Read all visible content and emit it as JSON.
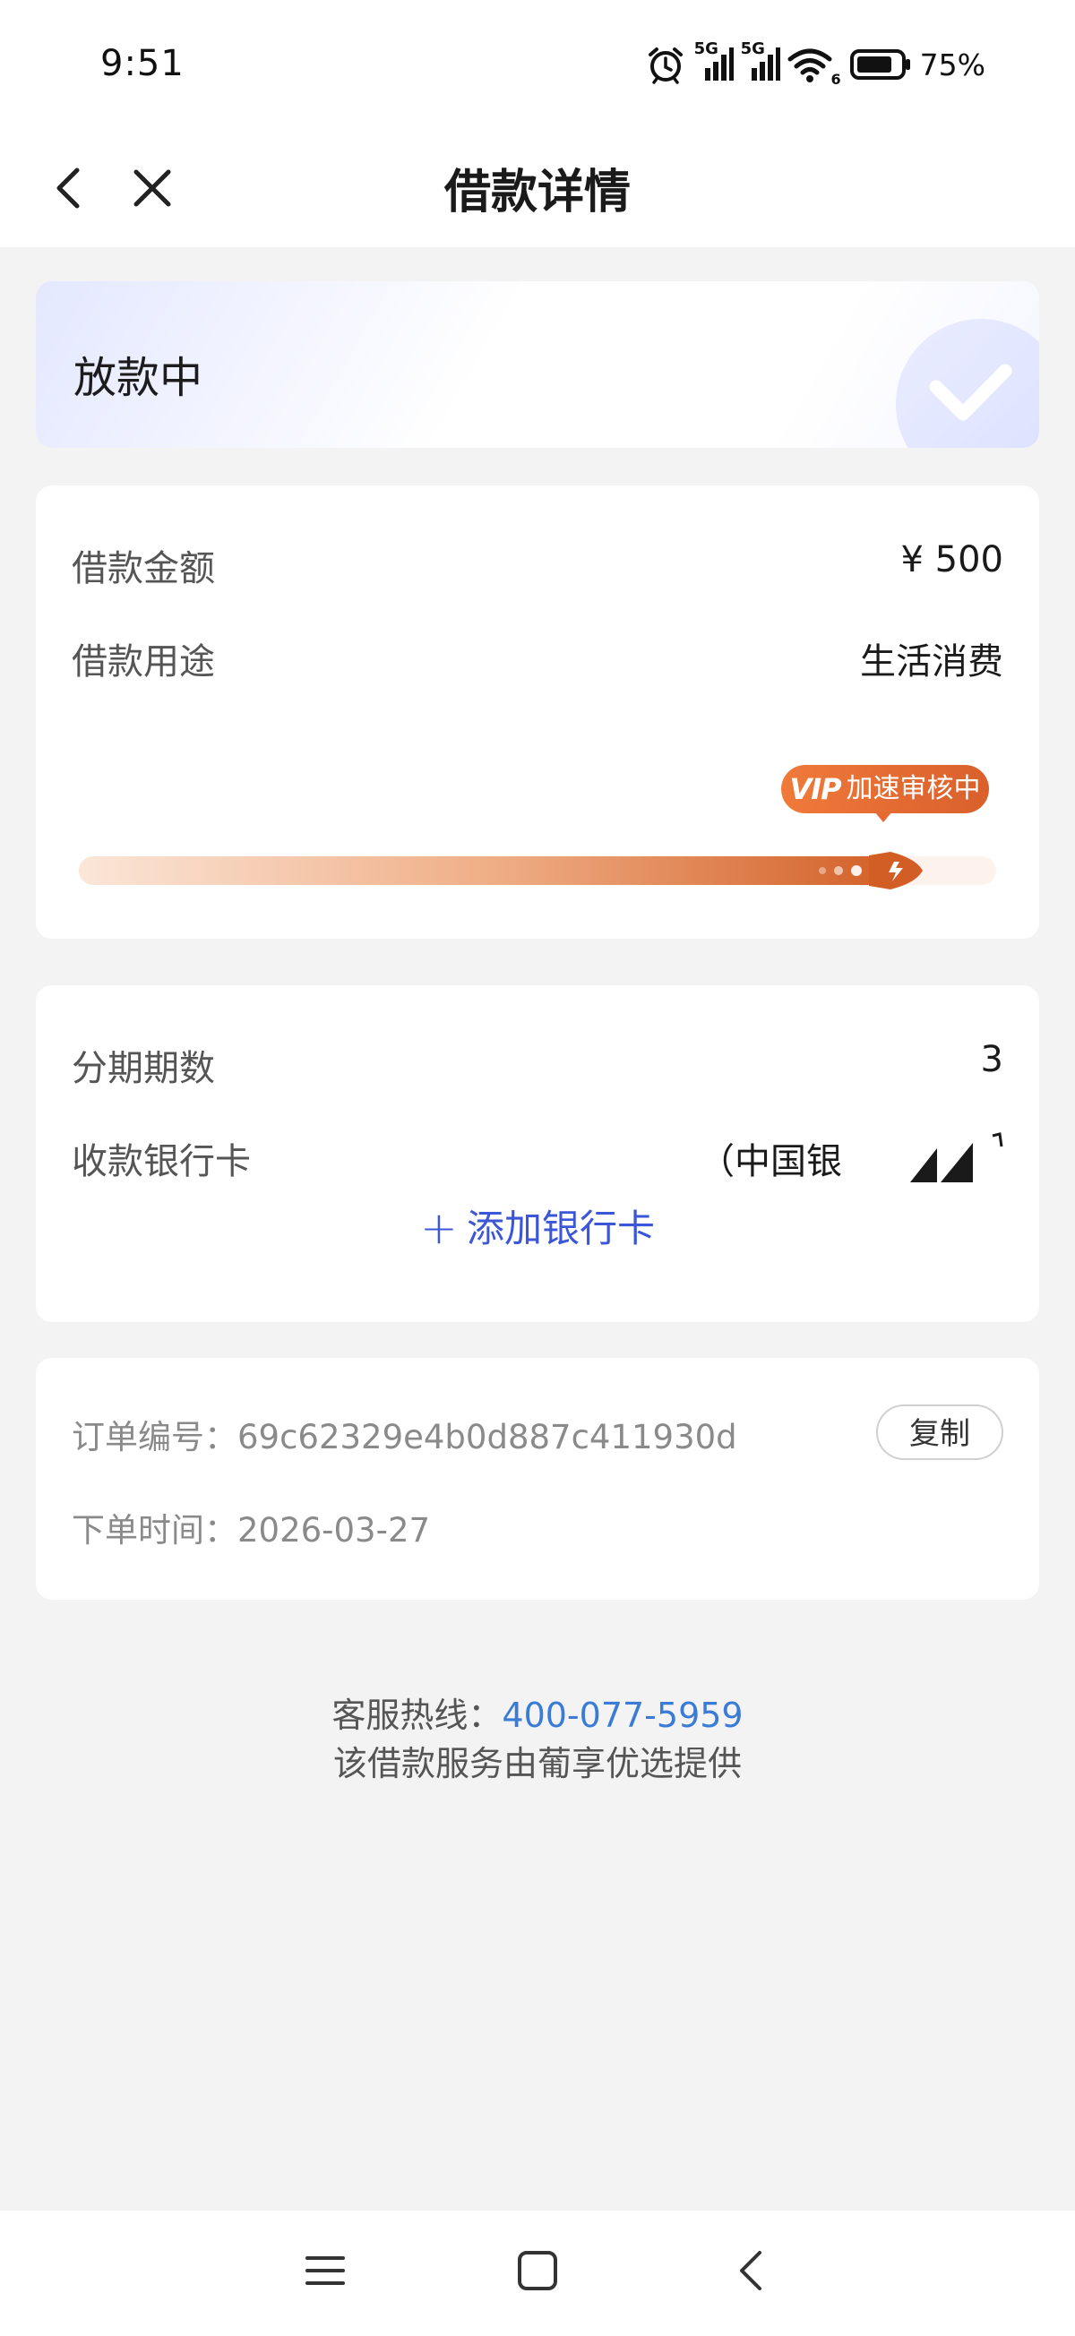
{
  "status_bar": {
    "time": "9:51",
    "network_1": "5G",
    "network_2": "5G",
    "wifi_badge": "6",
    "battery": "75%",
    "icons": [
      "alarm-icon",
      "signal-icon",
      "signal-icon",
      "wifi-icon",
      "battery-icon"
    ]
  },
  "header": {
    "title": "借款详情",
    "back_icon": "chevron-left-icon",
    "close_icon": "close-icon"
  },
  "status_card": {
    "status": "放款中",
    "icon": "check-icon"
  },
  "loan_card": {
    "amount_label": "借款金额",
    "amount_value": "¥ 500",
    "purpose_label": "借款用途",
    "purpose_value": "生活消费",
    "progress_badge_vip": "VIP",
    "progress_badge_text": "加速审核中",
    "progress": 0.9
  },
  "bank_card": {
    "installments_label": "分期期数",
    "installments_value": "3",
    "receiving_card_label": "收款银行卡",
    "receiving_card_value": "（中国银",
    "add_card_icon": "plus-icon",
    "add_card_label": "添加银行卡"
  },
  "order_card": {
    "order_no_label": "订单编号：",
    "order_no_value": "69c62329e4b0d887c411930d",
    "copy_label": "复制",
    "order_time_label": "下单时间：",
    "order_time_value": "2026-03-27"
  },
  "footer": {
    "hotline_label": "客服热线：",
    "hotline_number": "400-077-5959",
    "provider_text": "该借款服务由葡享优选提供"
  },
  "nav_bar": {
    "icons": [
      "menu-icon",
      "home-icon",
      "back-icon"
    ]
  },
  "colors": {
    "accent_blue": "#3b56d6",
    "link_blue": "#3a7bd5",
    "progress_orange": "#d9602c",
    "background": "#f3f3f3"
  }
}
